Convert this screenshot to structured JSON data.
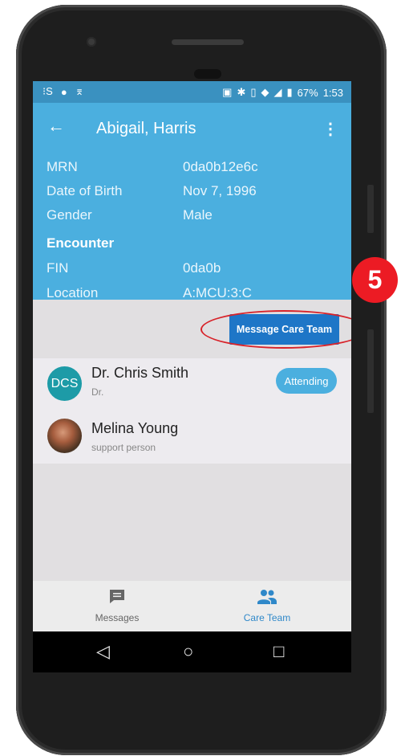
{
  "status": {
    "left_icons": [
      "sim-icon",
      "android-icon",
      "transfer-icon"
    ],
    "battery": "67%",
    "time": "1:53"
  },
  "header": {
    "title": "Abigail, Harris"
  },
  "patient": {
    "rows": [
      {
        "label": "MRN",
        "value": "0da0b12e6c"
      },
      {
        "label": "Date of Birth",
        "value": "Nov 7, 1996"
      },
      {
        "label": "Gender",
        "value": "Male"
      }
    ],
    "encounter_label": "Encounter",
    "encounter_rows": [
      {
        "label": "FIN",
        "value": "0da0b"
      },
      {
        "label": "Location",
        "value": "A:MCU:3:C"
      }
    ]
  },
  "actions": {
    "message_care_team": "Message Care Team"
  },
  "care_team": [
    {
      "initials": "DCS",
      "name": "Dr. Chris Smith",
      "role": "Dr.",
      "badge": "Attending"
    },
    {
      "name": "Melina Young",
      "role": "support person"
    }
  ],
  "nav": {
    "messages": "Messages",
    "care_team": "Care Team"
  },
  "step_marker": "5",
  "colors": {
    "header": "#4bafdf",
    "statusbar": "#3a91c0",
    "button": "#1e76c7",
    "marker": "#ec1b24"
  }
}
